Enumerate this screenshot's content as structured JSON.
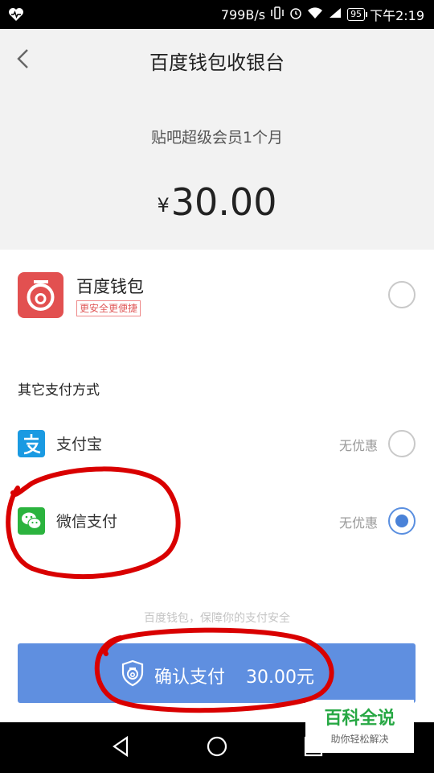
{
  "status_bar": {
    "speed": "799B/s",
    "battery": "95",
    "time": "下午2:19"
  },
  "header": {
    "title": "百度钱包收银台"
  },
  "order": {
    "product": "贴吧超级会员1个月",
    "currency": "¥",
    "amount": "30.00"
  },
  "wallet": {
    "name": "百度钱包",
    "tag": "更安全更便捷",
    "selected": false
  },
  "other_methods": {
    "label": "其它支付方式",
    "items": [
      {
        "name": "支付宝",
        "promo": "无优惠",
        "selected": false,
        "icon": "alipay-icon"
      },
      {
        "name": "微信支付",
        "promo": "无优惠",
        "selected": true,
        "icon": "wechat-pay-icon"
      }
    ]
  },
  "security_note": "百度钱包，保障你的支付安全",
  "confirm": {
    "label": "确认支付",
    "amount": "30.00元"
  },
  "watermark": {
    "title": "百科全说",
    "subtitle": "助你轻松解决"
  },
  "colors": {
    "primary_button": "#5f8fe0",
    "radio_selected": "#4a82d8",
    "wallet_logo": "#e25050",
    "annotation": "#d90000"
  }
}
